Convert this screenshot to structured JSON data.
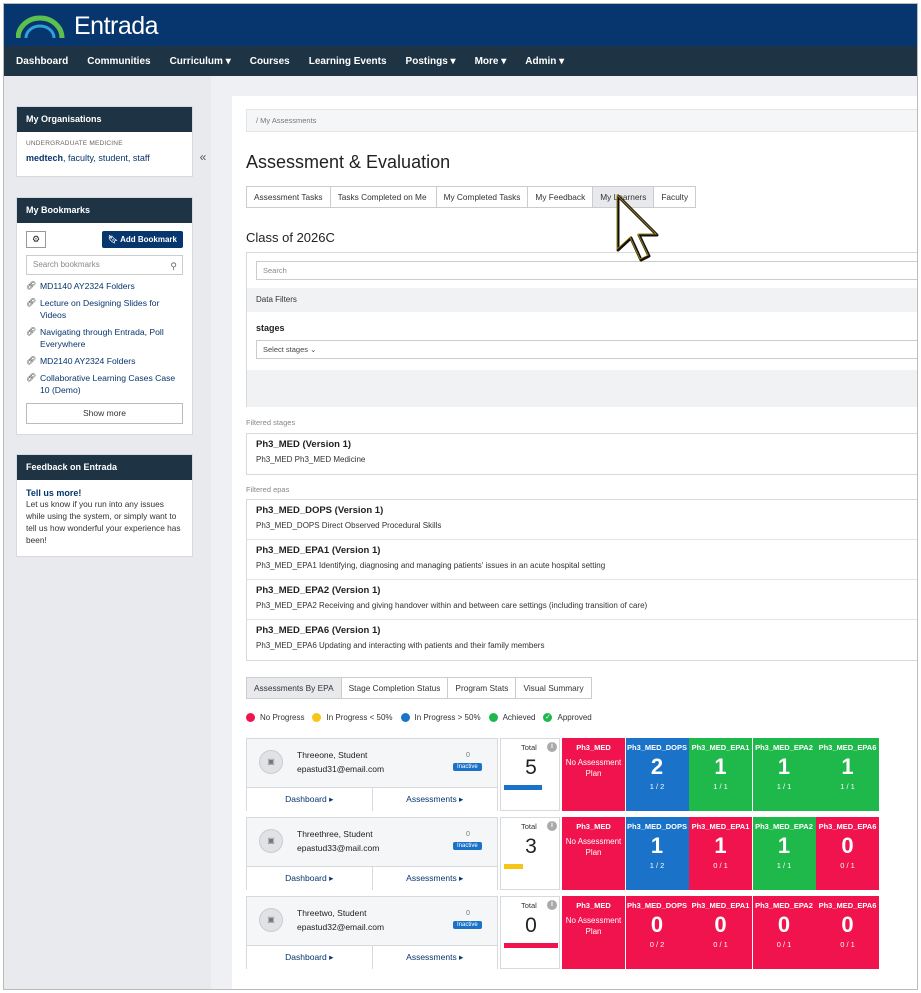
{
  "app": {
    "logo_text": "Entrada"
  },
  "nav": [
    "Dashboard",
    "Communities",
    "Curriculum ▾",
    "Courses",
    "Learning Events",
    "Postings ▾",
    "More ▾",
    "Admin ▾"
  ],
  "sidebar": {
    "collapse": "«",
    "organisations": {
      "title": "My Organisations",
      "category": "UNDERGRADUATE MEDICINE",
      "org": "medtech",
      "roles": ", faculty, student, staff"
    },
    "bookmarks": {
      "title": "My Bookmarks",
      "add_label": "Add Bookmark",
      "search_placeholder": "Search bookmarks",
      "items": [
        "MD1140 AY2324 Folders",
        "Lecture on Designing Slides for Videos",
        "Navigating through Entrada, Poll Everywhere",
        "MD2140 AY2324 Folders",
        "Collaborative Learning Cases Case 10 (Demo)"
      ],
      "show_more": "Show more"
    },
    "feedback": {
      "title": "Feedback on Entrada",
      "link": "Tell us more!",
      "text": "Let us know if you run into any issues while using the system, or simply want to tell us how wonderful your experience has been!"
    }
  },
  "main": {
    "breadcrumb": "/  My Assessments",
    "title": "Assessment & Evaluation",
    "tabs": [
      "Assessment Tasks",
      "Tasks Completed on Me",
      "My Completed Tasks",
      "My Feedback",
      "My Learners",
      "Faculty"
    ],
    "class_title": "Class of 2026C",
    "filters": {
      "search_placeholder": "Search",
      "data_filters": "Data Filters",
      "stages_label": "stages",
      "select_stages": "Select stages ⌄"
    },
    "filtered_stages_label": "Filtered stages",
    "stages": [
      {
        "title": "Ph3_MED (Version 1)",
        "desc": "Ph3_MED Ph3_MED Medicine"
      }
    ],
    "filtered_epas_label": "Filtered epas",
    "epas": [
      {
        "title": "Ph3_MED_DOPS (Version 1)",
        "desc": "Ph3_MED_DOPS Direct Observed Procedural Skills"
      },
      {
        "title": "Ph3_MED_EPA1 (Version 1)",
        "desc": "Ph3_MED_EPA1 Identifying, diagnosing and managing patients' issues in an acute hospital setting"
      },
      {
        "title": "Ph3_MED_EPA2 (Version 1)",
        "desc": "Ph3_MED_EPA2 Receiving and giving handover within and between care settings (including transition of care)"
      },
      {
        "title": "Ph3_MED_EPA6 (Version 1)",
        "desc": "Ph3_MED_EPA6 Updating and interacting with patients and their family members"
      }
    ],
    "view_tabs": [
      "Assessments By EPA",
      "Stage Completion Status",
      "Program Stats",
      "Visual Summary"
    ],
    "legend": [
      {
        "label": "No Progress",
        "color": "#f0134d"
      },
      {
        "label": "In Progress < 50%",
        "color": "#f5c518"
      },
      {
        "label": "In Progress > 50%",
        "color": "#1a73c9"
      },
      {
        "label": "Achieved",
        "color": "#1fb84a"
      },
      {
        "label": "Approved",
        "color": "#1fb84a"
      }
    ],
    "learners": [
      {
        "name": "Threeone, Student",
        "email": "epastud31@email.com",
        "count": "0",
        "badge": "Inactive",
        "dashboard": "Dashboard ▸",
        "assessments": "Assessments ▸",
        "total_label": "Total",
        "total": "5",
        "bar_color": "#1a73c9",
        "bar_fraction": 0.7,
        "tiles": [
          {
            "head": "Ph3_MED",
            "big": "",
            "sub": "",
            "nap": "No Assessment Plan",
            "color": "#f0134d"
          },
          {
            "head": "Ph3_MED_DOPS",
            "big": "2",
            "sub": "1 / 2",
            "color": "#1a73c9"
          },
          {
            "head": "Ph3_MED_EPA1",
            "big": "1",
            "sub": "1 / 1",
            "color": "#1fb84a"
          },
          {
            "head": "Ph3_MED_EPA2",
            "big": "1",
            "sub": "1 / 1",
            "color": "#1fb84a"
          },
          {
            "head": "Ph3_MED_EPA6",
            "big": "1",
            "sub": "1 / 1",
            "color": "#1fb84a"
          }
        ]
      },
      {
        "name": "Threethree, Student",
        "email": "epastud33@mail.com",
        "count": "0",
        "badge": "Inactive",
        "dashboard": "Dashboard ▸",
        "assessments": "Assessments ▸",
        "total_label": "Total",
        "total": "3",
        "bar_color": "#f5c518",
        "bar_fraction": 0.35,
        "tiles": [
          {
            "head": "Ph3_MED",
            "big": "",
            "sub": "",
            "nap": "No Assessment Plan",
            "color": "#f0134d"
          },
          {
            "head": "Ph3_MED_DOPS",
            "big": "1",
            "sub": "1 / 2",
            "color": "#1a73c9"
          },
          {
            "head": "Ph3_MED_EPA1",
            "big": "1",
            "sub": "0 / 1",
            "color": "#f0134d"
          },
          {
            "head": "Ph3_MED_EPA2",
            "big": "1",
            "sub": "1 / 1",
            "color": "#1fb84a"
          },
          {
            "head": "Ph3_MED_EPA6",
            "big": "0",
            "sub": "0 / 1",
            "color": "#f0134d"
          }
        ]
      },
      {
        "name": "Threetwo, Student",
        "email": "epastud32@email.com",
        "count": "0",
        "badge": "Inactive",
        "dashboard": "Dashboard ▸",
        "assessments": "Assessments ▸",
        "total_label": "Total",
        "total": "0",
        "bar_color": "#f0134d",
        "bar_fraction": 1.0,
        "tiles": [
          {
            "head": "Ph3_MED",
            "big": "",
            "sub": "",
            "nap": "No Assessment Plan",
            "color": "#f0134d"
          },
          {
            "head": "Ph3_MED_DOPS",
            "big": "0",
            "sub": "0 / 2",
            "color": "#f0134d"
          },
          {
            "head": "Ph3_MED_EPA1",
            "big": "0",
            "sub": "0 / 1",
            "color": "#f0134d"
          },
          {
            "head": "Ph3_MED_EPA2",
            "big": "0",
            "sub": "0 / 1",
            "color": "#f0134d"
          },
          {
            "head": "Ph3_MED_EPA6",
            "big": "0",
            "sub": "0 / 1",
            "color": "#f0134d"
          }
        ]
      }
    ]
  }
}
